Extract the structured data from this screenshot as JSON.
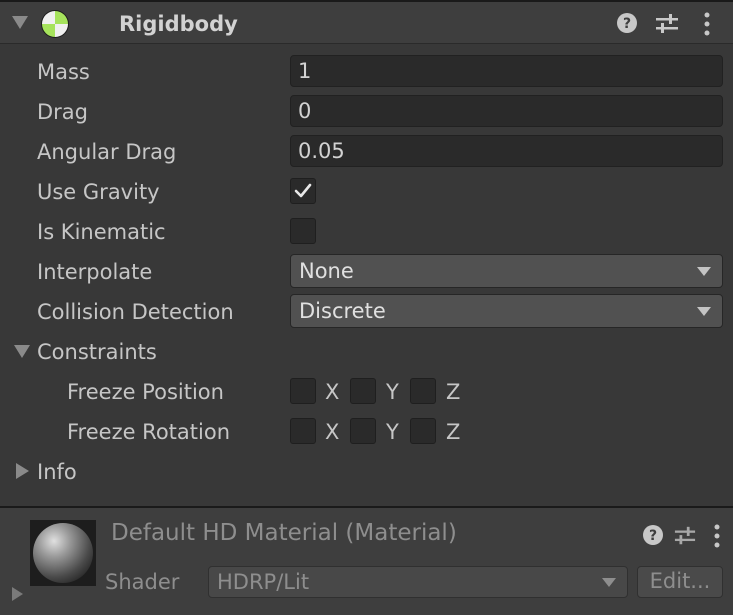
{
  "component": {
    "title": "Rigidbody",
    "help_icon": "help-icon",
    "presets_icon": "presets-sliders-icon",
    "menu_icon": "more-vertical-icon"
  },
  "fields": {
    "mass": {
      "label": "Mass",
      "value": "1"
    },
    "drag": {
      "label": "Drag",
      "value": "0"
    },
    "angular_drag": {
      "label": "Angular Drag",
      "value": "0.05"
    },
    "use_gravity": {
      "label": "Use Gravity",
      "checked": true
    },
    "is_kinematic": {
      "label": "Is Kinematic",
      "checked": false
    },
    "interpolate": {
      "label": "Interpolate",
      "value": "None"
    },
    "collision_detection": {
      "label": "Collision Detection",
      "value": "Discrete"
    }
  },
  "constraints": {
    "label": "Constraints",
    "freeze_position": {
      "label": "Freeze Position",
      "x": "X",
      "y": "Y",
      "z": "Z"
    },
    "freeze_rotation": {
      "label": "Freeze Rotation",
      "x": "X",
      "y": "Y",
      "z": "Z"
    }
  },
  "info": {
    "label": "Info"
  },
  "material": {
    "title": "Default HD Material (Material)",
    "shader_label": "Shader",
    "shader_value": "HDRP/Lit",
    "edit_label": "Edit..."
  },
  "colors": {
    "accent_green": "#a6e35c",
    "panel_bg": "#383838",
    "header_bg": "#3e3e3e"
  }
}
